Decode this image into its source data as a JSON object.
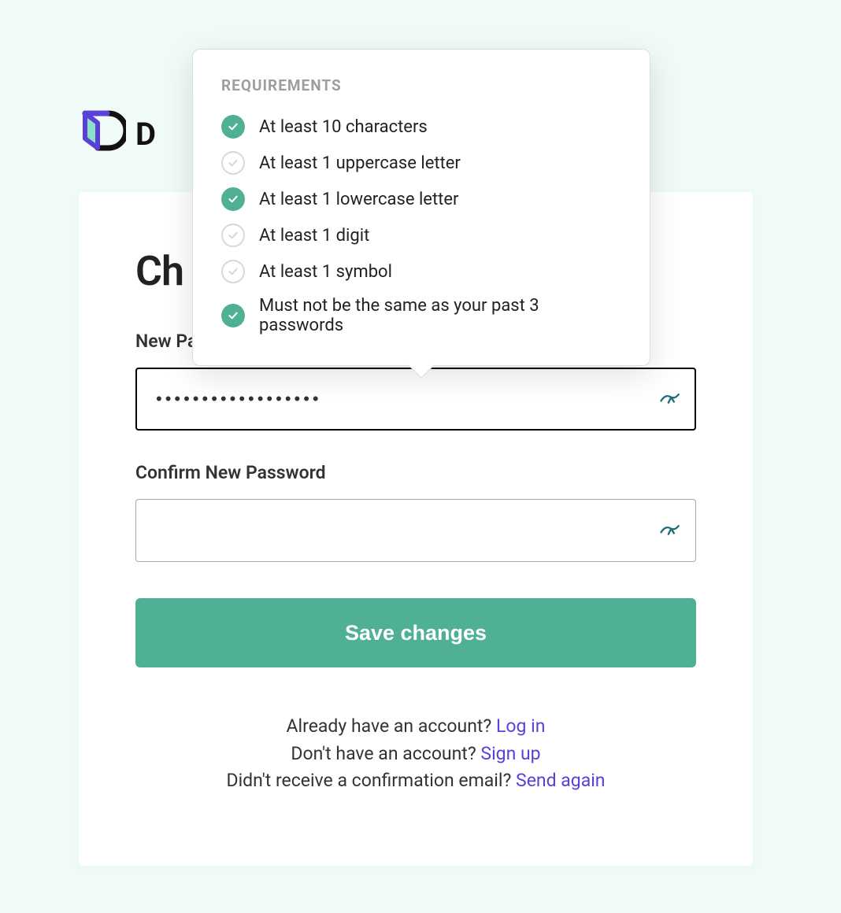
{
  "brand": {
    "name_prefix": "D"
  },
  "card": {
    "title_prefix": "Ch",
    "new_password_label": "New Password",
    "new_password_value": "••••••••••••••••••",
    "confirm_label": "Confirm New Password",
    "confirm_value": "",
    "save_button": "Save changes"
  },
  "links": {
    "have_account_text": "Already have an account? ",
    "login_link": "Log in",
    "no_account_text": "Don't have an account? ",
    "signup_link": "Sign up",
    "no_email_text": "Didn't receive a confirmation email? ",
    "resend_link": "Send again"
  },
  "requirements": {
    "title": "REQUIREMENTS",
    "items": [
      {
        "label": "At least 10 characters",
        "met": true
      },
      {
        "label": "At least 1 uppercase letter",
        "met": false
      },
      {
        "label": "At least 1 lowercase letter",
        "met": true
      },
      {
        "label": "At least 1 digit",
        "met": false
      },
      {
        "label": "At least 1 symbol",
        "met": false
      },
      {
        "label": "Must not be the same as your past 3 passwords",
        "met": true
      }
    ]
  },
  "colors": {
    "accent_green": "#4fb095",
    "link_purple": "#5b3fd9",
    "background": "#f0faf7"
  }
}
